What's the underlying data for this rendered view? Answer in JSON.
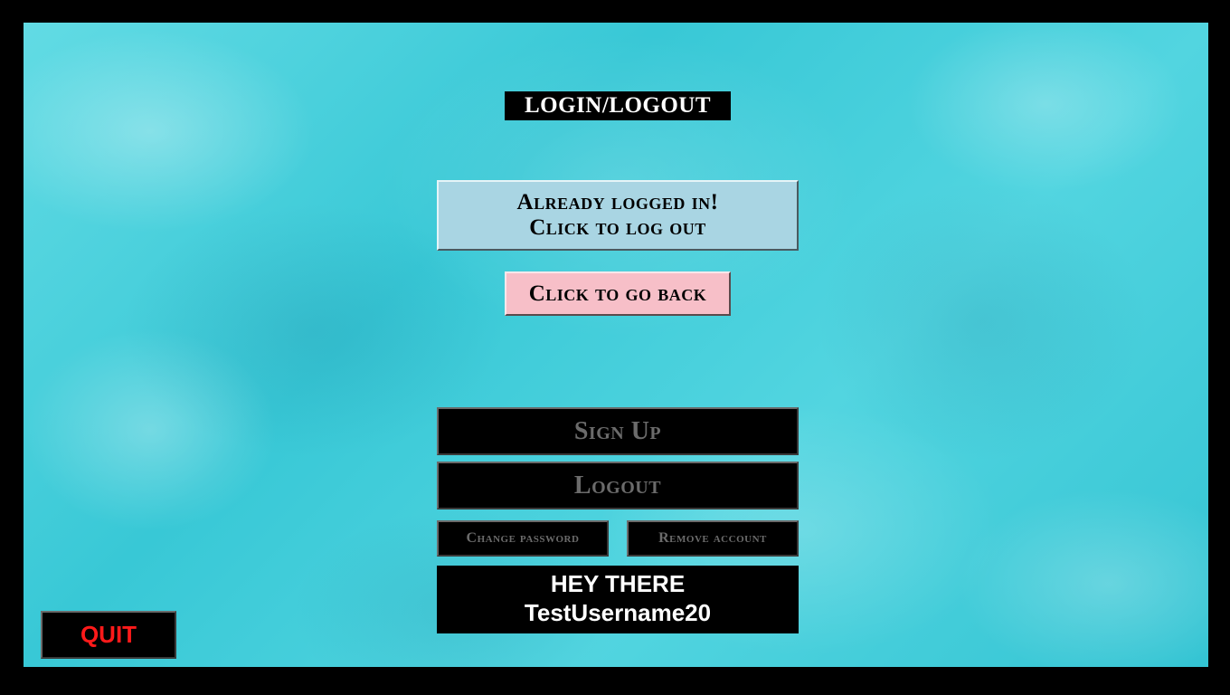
{
  "title": "LOGIN/LOGOUT",
  "logged_in_button": {
    "line1": "Already logged in!",
    "line2": "Click to log out"
  },
  "back_button": "Click to go back",
  "sign_up_button": "Sign Up",
  "logout_button": "Logout",
  "change_password_button": "Change password",
  "remove_account_button": "Remove account",
  "greeting": {
    "line1": "HEY THERE",
    "username": "TestUsername20"
  },
  "quit_button": "QUIT",
  "colors": {
    "background": "#3fd0dc",
    "logged_in_button": "#a9d5e3",
    "back_button": "#f7bfc8",
    "disabled_text": "#6b6b6b",
    "quit_text": "#ff1a1a"
  }
}
